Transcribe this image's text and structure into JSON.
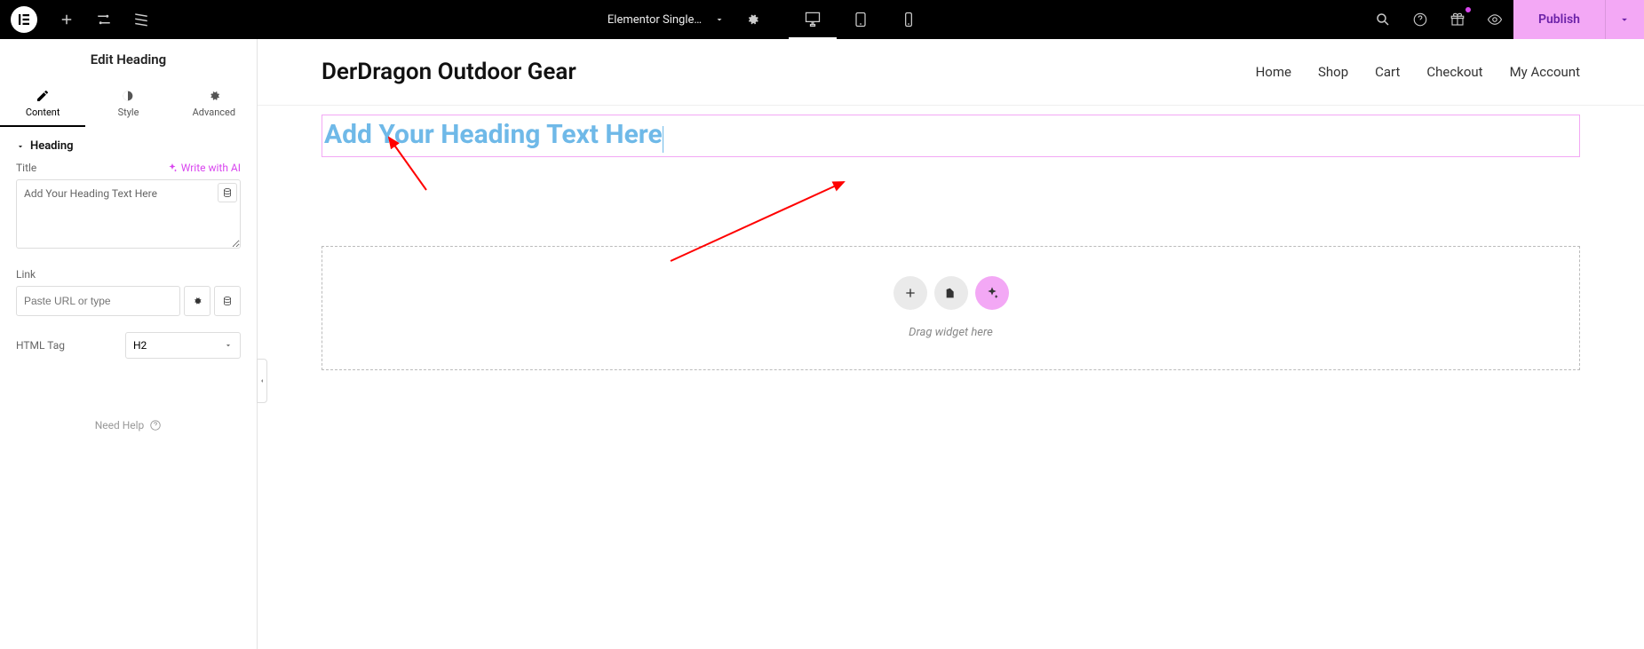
{
  "topbar": {
    "doc_title": "Elementor Single…",
    "publish_label": "Publish"
  },
  "sidebar": {
    "panel_title": "Edit Heading",
    "tabs": {
      "content": "Content",
      "style": "Style",
      "advanced": "Advanced"
    },
    "section": "Heading",
    "title_label": "Title",
    "ai_label": "Write with AI",
    "title_value": "Add Your Heading Text Here",
    "link_label": "Link",
    "link_placeholder": "Paste URL or type",
    "htmltag_label": "HTML Tag",
    "htmltag_value": "H2",
    "help_label": "Need Help"
  },
  "page": {
    "site_title": "DerDragon Outdoor Gear",
    "nav": {
      "home": "Home",
      "shop": "Shop",
      "cart": "Cart",
      "checkout": "Checkout",
      "account": "My Account"
    },
    "heading_text": "Add Your Heading Text Here",
    "drop_text": "Drag widget here"
  }
}
